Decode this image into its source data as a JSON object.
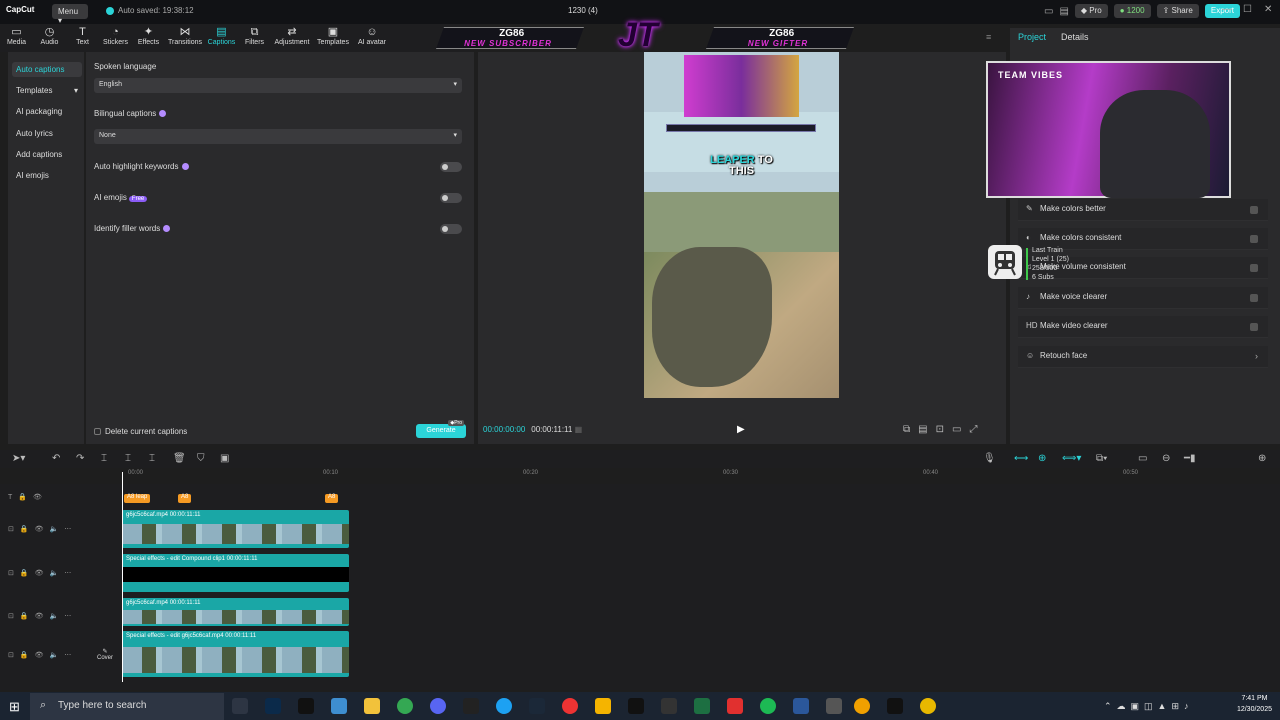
{
  "titlebar": {
    "logo": "CapCut",
    "menu": "Menu",
    "autosave": "Auto saved: 19:38:12",
    "project": "1230 (4)",
    "pro": "Pro",
    "credits": "1200",
    "share": "Share",
    "export": "Export"
  },
  "toolbar": [
    {
      "label": "Media",
      "icon": "▭"
    },
    {
      "label": "Audio",
      "icon": "◷"
    },
    {
      "label": "Text",
      "icon": "T"
    },
    {
      "label": "Stickers",
      "icon": "◔"
    },
    {
      "label": "Effects",
      "icon": "✦"
    },
    {
      "label": "Transitions",
      "icon": "⋈"
    },
    {
      "label": "Captions",
      "icon": "▤"
    },
    {
      "label": "Filters",
      "icon": "⧉"
    },
    {
      "label": "Adjustment",
      "icon": "⇄"
    },
    {
      "label": "Templates",
      "icon": "▣"
    },
    {
      "label": "AI avatar",
      "icon": "☺"
    }
  ],
  "banner": {
    "left_title": "ZG86",
    "left_sub": "NEW SUBSCRIBER",
    "right_title": "ZG86",
    "right_sub": "NEW GIFTER",
    "logo": "JT"
  },
  "sidebar": [
    "Auto captions",
    "Templates",
    "AI packaging",
    "Auto lyrics",
    "Add captions",
    "AI emojis"
  ],
  "captions": {
    "spoken_language_label": "Spoken language",
    "spoken_language_value": "English",
    "bilingual_label": "Bilingual captions",
    "bilingual_value": "None",
    "auto_highlight_label": "Auto highlight keywords",
    "ai_emojis_label": "AI emojis",
    "free_badge": "Free",
    "filler_label": "Identify filler words",
    "delete_label": "Delete current captions",
    "generate": "Generate",
    "pro_badge": "Pro"
  },
  "preview": {
    "caption_hl": "LEAPER",
    "caption_1": "TO",
    "caption_2": "THIS",
    "current_time": "00:00:00:00",
    "total_time": "00:00:11:11"
  },
  "right_panel": {
    "tabs": [
      "Project",
      "Details"
    ],
    "webcam_label": "TEAM VIBES",
    "enhance": [
      {
        "icon": "✎",
        "label": "Make colors better"
      },
      {
        "icon": "◐",
        "label": "Make colors consistent"
      },
      {
        "icon": "♫",
        "label": "Make volume consistent"
      },
      {
        "icon": "♪",
        "label": "Make voice clearer"
      },
      {
        "icon": "HD",
        "label": "Make video clearer"
      },
      {
        "icon": "☺",
        "label": "Retouch face"
      }
    ],
    "train": {
      "line1": "Last Train",
      "line2": "Level 1 (25)",
      "line3": "258/500",
      "line4": "6 Subs"
    }
  },
  "timeline": {
    "ruler": [
      "00:00",
      "00:10",
      "00:20",
      "00:30",
      "00:40",
      "00:50"
    ],
    "tags": [
      "A8 leap",
      "A8",
      "A8"
    ],
    "tracks": [
      {
        "label": "g6jc5c6caf.mp4  00:00:11:11"
      },
      {
        "label": "Special effects - edit  Compound clip1  00:00:11:11"
      },
      {
        "label": "g6jc5c6caf.mp4  00:00:11:11"
      },
      {
        "label": "Special effects - edit  g6jc5c6caf.mp4  00:00:11:11"
      }
    ],
    "cover": "Cover"
  },
  "taskbar": {
    "search_placeholder": "Type here to search",
    "time": "7:41 PM",
    "date": "12/30/2025"
  }
}
